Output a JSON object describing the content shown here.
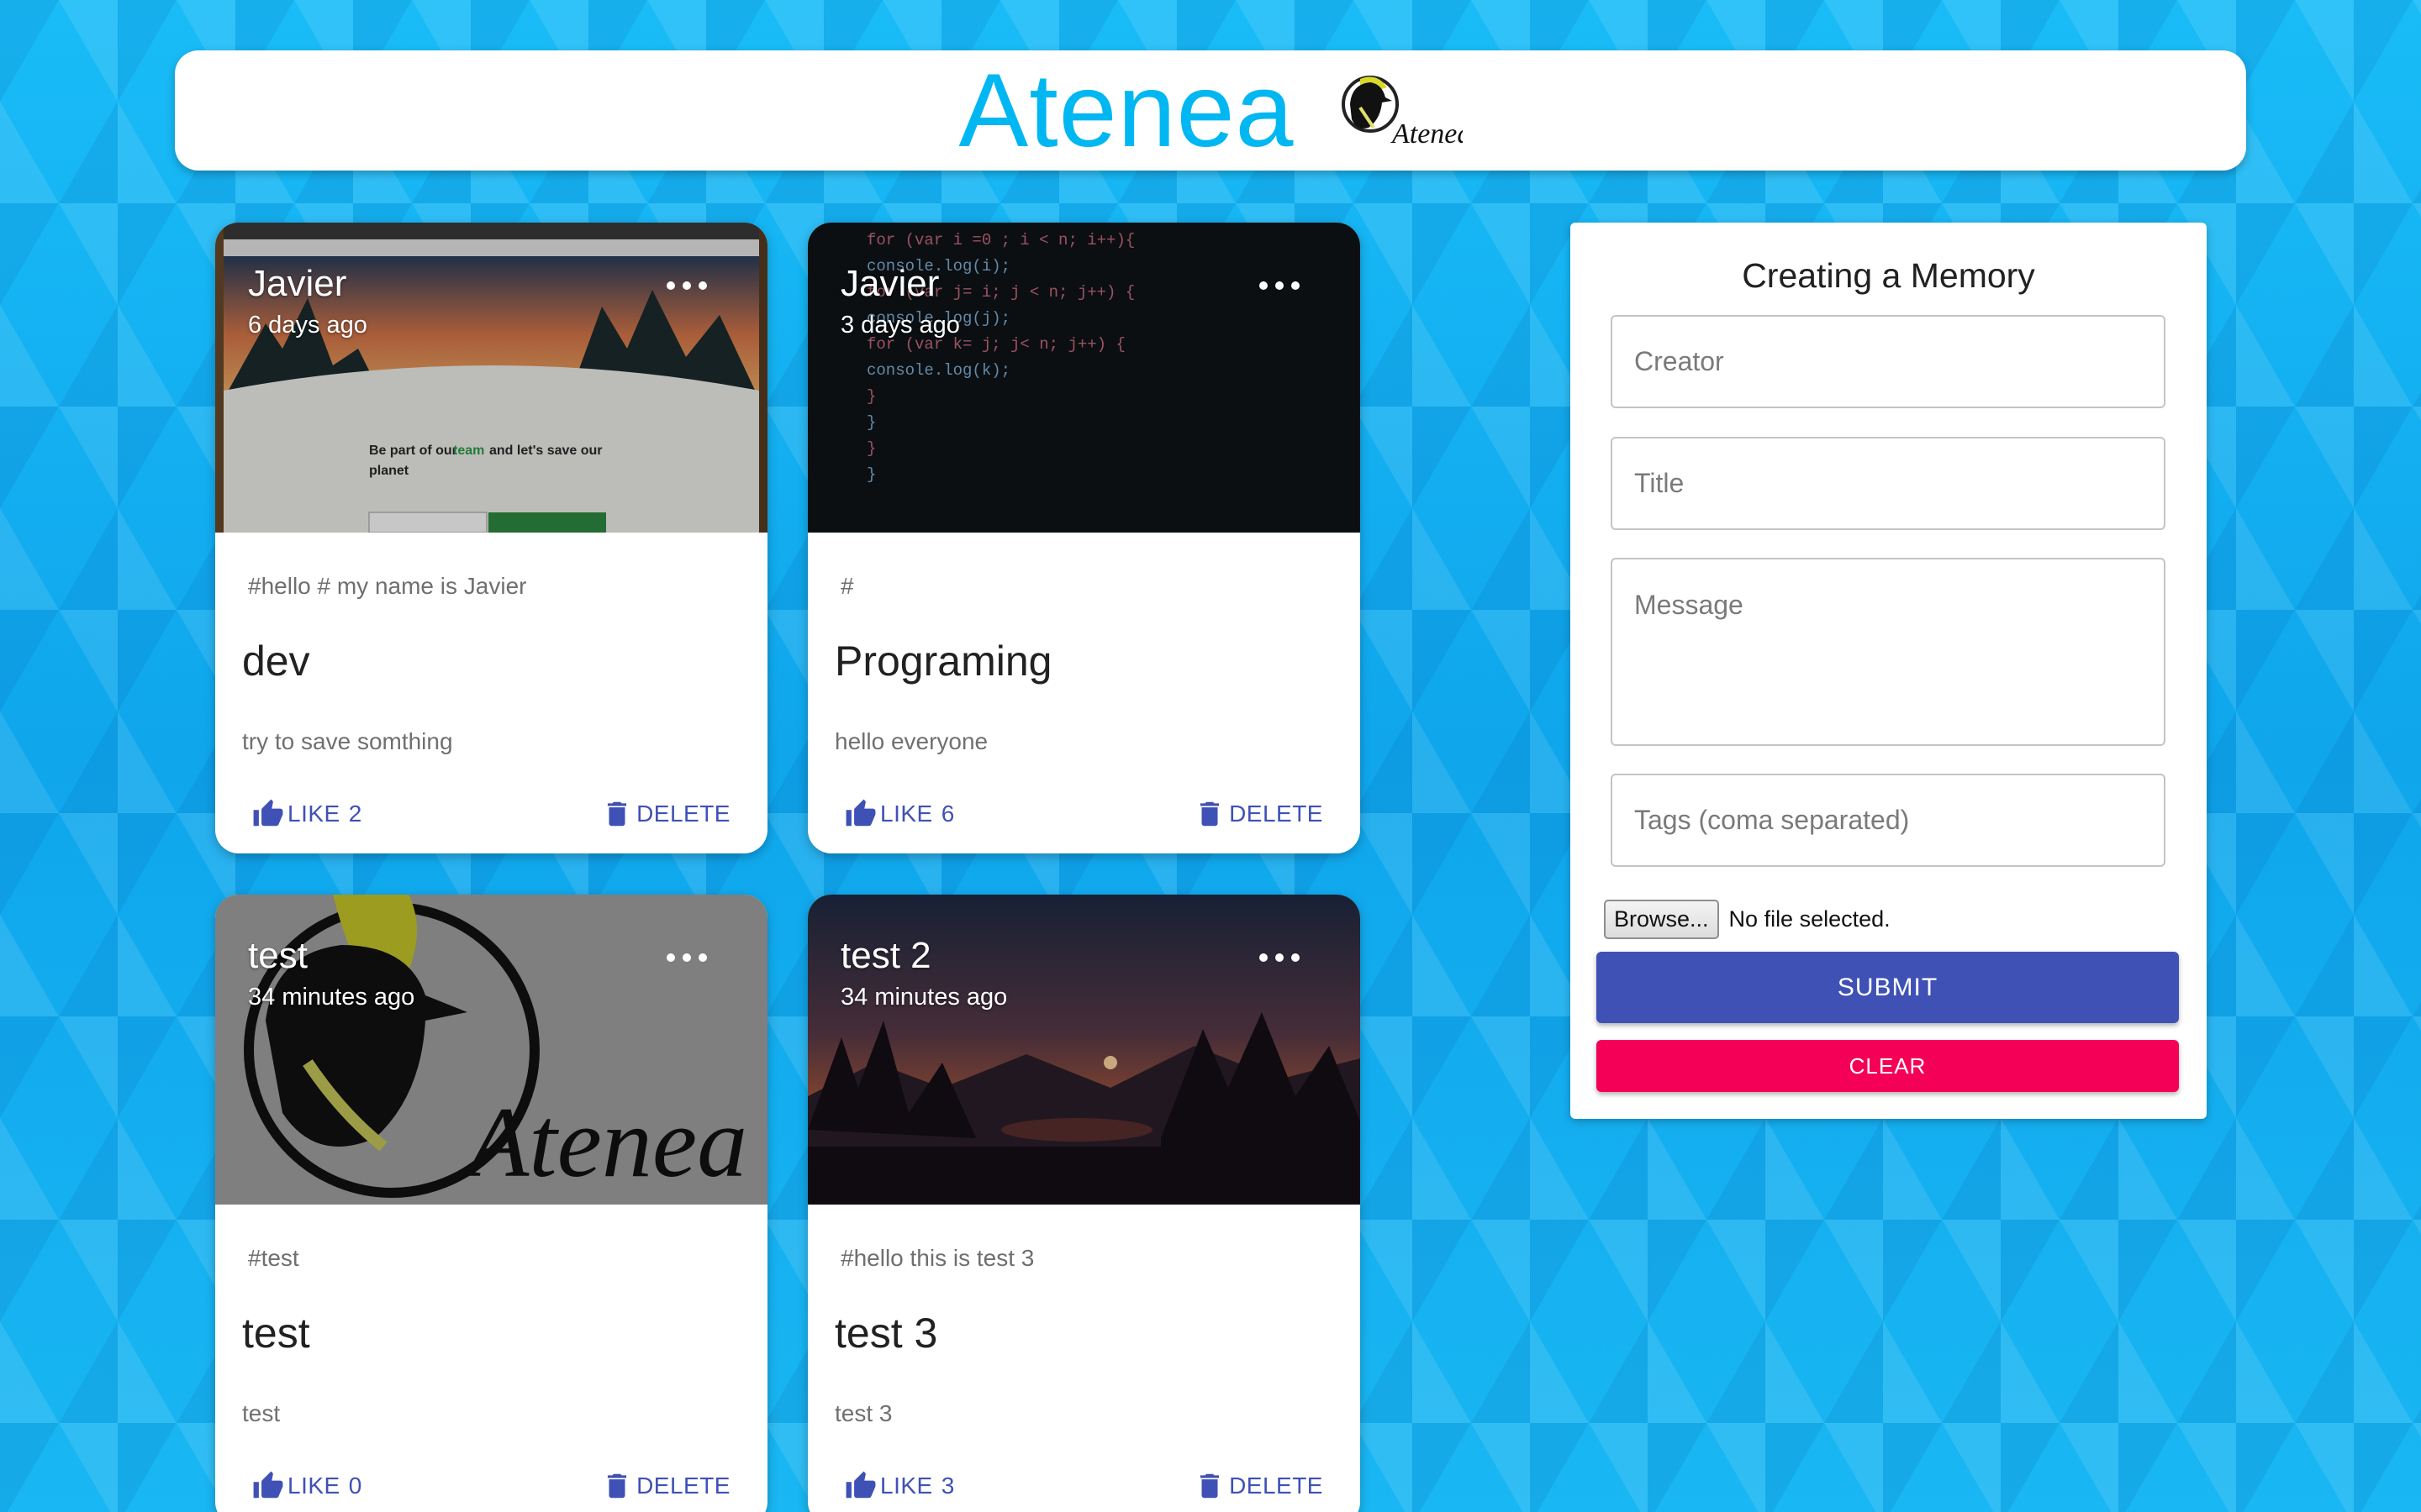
{
  "header": {
    "title": "Atenea",
    "logo_text": "Atenea"
  },
  "posts": [
    {
      "creator": "Javier",
      "time": "6 days ago",
      "tags": "#hello # my name is Javier",
      "title": "dev",
      "message": "try to save somthing",
      "like_label": "LIKE",
      "like_count": "2",
      "delete_label": "DELETE",
      "media": "website-screenshot",
      "media_texts": [
        "Be part of our",
        "team",
        "and let's save our",
        "planet"
      ]
    },
    {
      "creator": "Javier",
      "time": "3 days ago",
      "tags": "#",
      "title": "Programing",
      "message": "hello everyone",
      "like_label": "LIKE",
      "like_count": "6",
      "delete_label": "DELETE",
      "media": "code-screenshot",
      "code_lines": [
        "for (var i =0 ; i < n; i++){",
        "  console.log(i);",
        "  for (var j= i; j < n; j++) {",
        "    console.log(j);",
        "    for (var k= j; j< n; j++) {",
        "      console.log(k);",
        "    }",
        "  }",
        "}",
        "}"
      ]
    },
    {
      "creator": "test",
      "time": "34 minutes ago",
      "tags": "#test",
      "title": "test",
      "message": "test",
      "like_label": "LIKE",
      "like_count": "0",
      "delete_label": "DELETE",
      "media": "atenea-logo",
      "media_texts": [
        "Atenea"
      ]
    },
    {
      "creator": "test 2",
      "time": "34 minutes ago",
      "tags": "#hello this is test 3",
      "title": "test 3",
      "message": "test 3",
      "like_label": "LIKE",
      "like_count": "3",
      "delete_label": "DELETE",
      "media": "sunset-landscape"
    }
  ],
  "form": {
    "title": "Creating a Memory",
    "creator_placeholder": "Creator",
    "title_placeholder": "Title",
    "message_placeholder": "Message",
    "tags_placeholder": "Tags (coma separated)",
    "file_button": "Browse...",
    "file_status": "No file selected.",
    "submit_label": "SUBMIT",
    "clear_label": "CLEAR"
  },
  "colors": {
    "primary": "#3f51b5",
    "secondary": "#f50057",
    "title_blue": "#00b7f1",
    "background": "#16b4f4"
  }
}
